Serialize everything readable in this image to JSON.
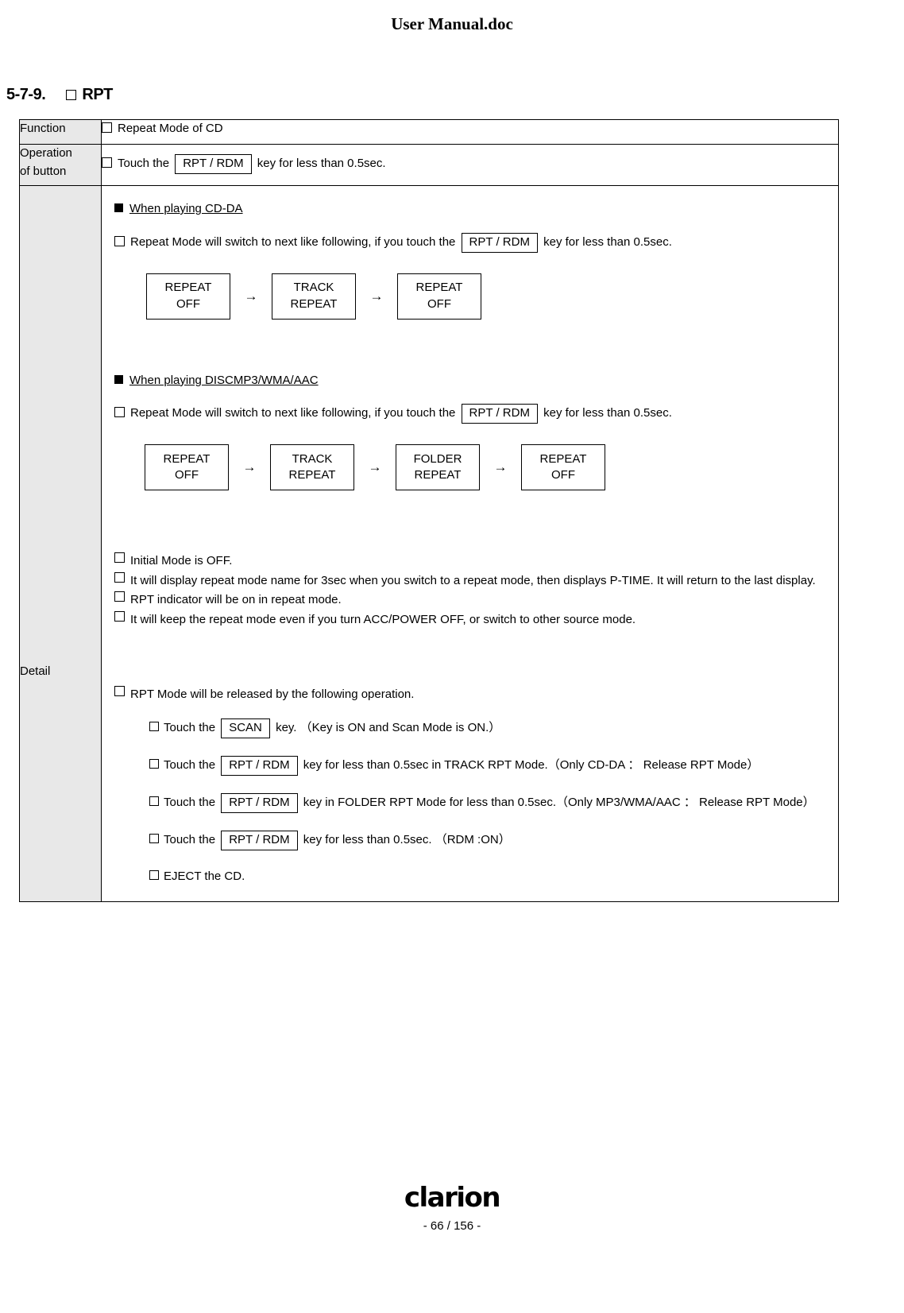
{
  "document": {
    "title": "User Manual.doc",
    "section_number": "5-7-9.",
    "section_title": "RPT"
  },
  "table": {
    "labels": {
      "function": "Function",
      "operation_line1": "Operation",
      "operation_line2": "of button",
      "detail": "Detail"
    },
    "function_text": "Repeat Mode of CD",
    "operation": {
      "prefix": "Touch the",
      "key": "RPT / RDM",
      "suffix": "key for less than 0.5sec."
    },
    "detail": {
      "cdda": {
        "heading": "When playing CD-DA",
        "line_prefix": "Repeat Mode will switch to next like following, if you touch the",
        "key": "RPT / RDM",
        "line_suffix": "key for less than 0.5sec.",
        "flow": [
          {
            "line1": "REPEAT",
            "line2": "OFF"
          },
          {
            "line1": "TRACK",
            "line2": "REPEAT"
          },
          {
            "line1": "REPEAT",
            "line2": "OFF"
          }
        ],
        "arrow": "→"
      },
      "mp3": {
        "heading": "When playing DISCMP3/WMA/AAC",
        "line_prefix": "Repeat Mode will switch to next like following, if you touch the",
        "key": "RPT / RDM",
        "line_suffix": "key for less than 0.5sec.",
        "flow": [
          {
            "line1": "REPEAT",
            "line2": "OFF"
          },
          {
            "line1": "TRACK",
            "line2": "REPEAT"
          },
          {
            "line1": "FOLDER",
            "line2": "REPEAT"
          },
          {
            "line1": "REPEAT",
            "line2": "OFF"
          }
        ],
        "arrow": "→"
      },
      "notes": [
        "Initial Mode is OFF.",
        "It will display repeat mode name for 3sec when you switch to a repeat mode, then displays P-TIME. It will return to the last display.",
        "RPT indicator will be on in repeat mode.",
        "It will keep the repeat mode even if you turn ACC/POWER  OFF, or switch to other source mode."
      ],
      "release_heading": "RPT Mode will be released by the following operation.",
      "release_items": [
        {
          "prefix": "Touch the",
          "key": "SCAN",
          "suffix": "key.  （Key is ON and Scan Mode is ON.）"
        },
        {
          "prefix": "Touch the",
          "key": "RPT / RDM",
          "suffix": "key for less than 0.5sec in TRACK RPT Mode.（Only CD-DA ： Release RPT Mode）"
        },
        {
          "prefix": "Touch the",
          "key": "RPT / RDM",
          "suffix": "key in FOLDER RPT Mode for less than 0.5sec.（Only MP3/WMA/AAC ： Release RPT Mode）"
        },
        {
          "prefix": "Touch the",
          "key": "RPT / RDM",
          "suffix": "key for less than 0.5sec.  （RDM :ON）"
        },
        {
          "prefix": "",
          "key": "",
          "suffix": "EJECT the CD."
        }
      ]
    }
  },
  "footer": {
    "logo": "clarion",
    "page": "- 66 / 156 -"
  }
}
